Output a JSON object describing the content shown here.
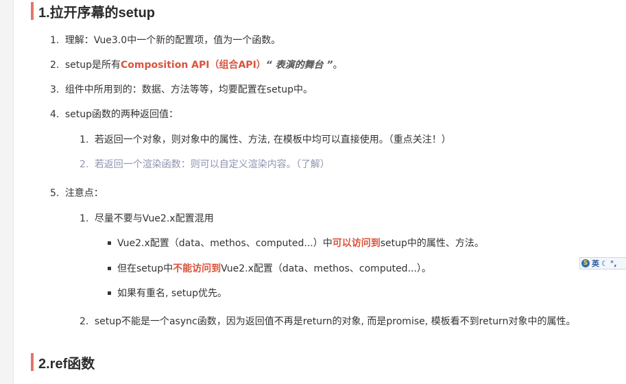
{
  "section1": {
    "title": "1.拉开序幕的setup",
    "items": [
      {
        "num": "1.",
        "text": "理解：Vue3.0中一个新的配置项，值为一个函数。"
      },
      {
        "num": "2.",
        "pre": "setup是所有",
        "highlight": "Composition API（组合API）",
        "emph": "“ 表演的舞台 ”",
        "post": "。"
      },
      {
        "num": "3.",
        "text": "组件中所用到的：数据、方法等等，均要配置在setup中。"
      },
      {
        "num": "4.",
        "text": "setup函数的两种返回值："
      },
      {
        "num": "5.",
        "text": "注意点："
      }
    ],
    "return_values": [
      {
        "num": "1.",
        "text": "若返回一个对象，则对象中的属性、方法, 在模板中均可以直接使用。（重点关注！）"
      },
      {
        "num": "2.",
        "text": "若返回一个渲染函数：则可以自定义渲染内容。（了解）"
      }
    ],
    "notes": [
      {
        "num": "1.",
        "text": "尽量不要与Vue2.x配置混用"
      },
      {
        "num": "2.",
        "text": "setup不能是一个async函数，因为返回值不再是return的对象, 而是promise, 模板看不到return对象中的属性。"
      }
    ],
    "bullets": [
      {
        "pre": "Vue2.x配置（data、methos、computed...）中",
        "highlight": "可以访问到",
        "post": "setup中的属性、方法。"
      },
      {
        "pre": "但在setup中",
        "highlight": "不能访问到",
        "post": "Vue2.x配置（data、methos、computed...）。"
      },
      {
        "pre": "如果有重名, setup优先。"
      }
    ]
  },
  "section2": {
    "title": "2.ref函数"
  },
  "ime": {
    "lang": "英",
    "icon": "input-method-icon"
  },
  "colors": {
    "accent": "#e4756a",
    "highlight": "#d9533c",
    "muted": "#8f93b0"
  }
}
